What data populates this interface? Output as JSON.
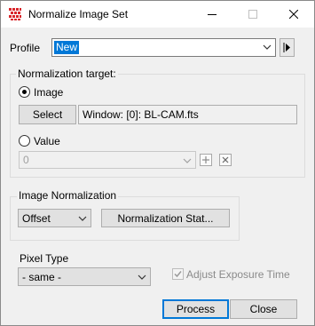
{
  "window": {
    "title": "Normalize Image Set",
    "controls": {
      "minimize": "minimize",
      "maximize": "maximize",
      "close": "close"
    }
  },
  "profile": {
    "label": "Profile",
    "value": "New"
  },
  "normalization_target": {
    "group_label": "Normalization target:",
    "image_radio_label": "Image",
    "image_selected": true,
    "select_button": "Select",
    "window_field": "Window: [0]: BL-CAM.fts",
    "value_radio_label": "Value",
    "value_field": "0"
  },
  "image_normalization": {
    "group_label": "Image Normalization",
    "method": "Offset",
    "stats_button": "Normalization Stat..."
  },
  "pixel_type": {
    "label": "Pixel Type",
    "value": "- same -",
    "adjust_exposure_label": "Adjust Exposure Time",
    "adjust_exposure_checked": true
  },
  "footer": {
    "process_button": "Process",
    "close_button": "Close"
  },
  "colors": {
    "accent": "#0078d7",
    "background": "#f0f0f0"
  }
}
